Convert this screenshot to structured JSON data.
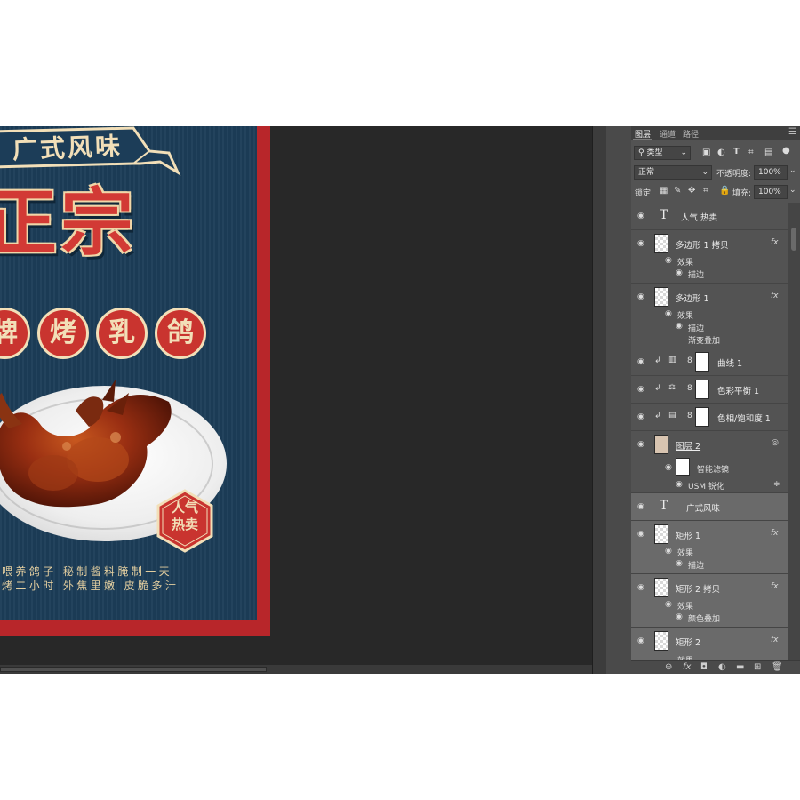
{
  "poster": {
    "banner_text": "广式风味",
    "title": "正宗",
    "circle_chars": [
      "牌",
      "烤",
      "乳",
      "鸽"
    ],
    "badge_line1": "人气",
    "badge_line2": "热卖",
    "desc_line1": "喂养鸽子 秘制酱料腌制一天",
    "desc_line2": "烤二小时 外焦里嫩 皮脆多汁"
  },
  "panel": {
    "tabs": [
      "图层",
      "通道",
      "路径"
    ],
    "menu_icon": "☰",
    "filter_label": "类型",
    "blend_mode": "正常",
    "opacity_label": "不透明度:",
    "opacity_value": "100%",
    "lock_label": "锁定:",
    "fill_label": "填充:",
    "fill_value": "100%"
  },
  "layers": [
    {
      "name": "人气 热卖",
      "kind": "text"
    },
    {
      "name": "多边形 1 拷贝",
      "kind": "shape",
      "fx": "fx",
      "subs": [
        "效果",
        "描边"
      ]
    },
    {
      "name": "多边形 1",
      "kind": "shape",
      "fx": "fx",
      "subs": [
        "效果",
        "描边",
        "渐变叠加"
      ]
    },
    {
      "name": "曲线 1",
      "kind": "adjust"
    },
    {
      "name": "色彩平衡 1",
      "kind": "adjust"
    },
    {
      "name": "色相/饱和度 1",
      "kind": "adjust"
    },
    {
      "name": "图层 2",
      "kind": "smart",
      "subs": [
        "智能滤镜",
        "USM 锐化"
      ]
    },
    {
      "name": "广式风味",
      "kind": "text"
    },
    {
      "name": "矩形 1",
      "kind": "shape",
      "fx": "fx",
      "subs": [
        "效果",
        "描边"
      ]
    },
    {
      "name": "矩形 2 拷贝",
      "kind": "shape",
      "fx": "fx",
      "subs": [
        "效果",
        "颜色叠加"
      ]
    },
    {
      "name": "矩形 2",
      "kind": "shape",
      "fx": "fx",
      "subs": [
        "效果"
      ]
    }
  ],
  "icons": {
    "eye": "👁",
    "text_layer": "T",
    "link": "8",
    "clip": "↲",
    "fx": "fx"
  },
  "colors": {
    "poster_blue": "#1c3d58",
    "poster_red": "#b8262a",
    "cream": "#f2dfb8",
    "panel_bg": "#535353",
    "workspace": "#282828"
  }
}
